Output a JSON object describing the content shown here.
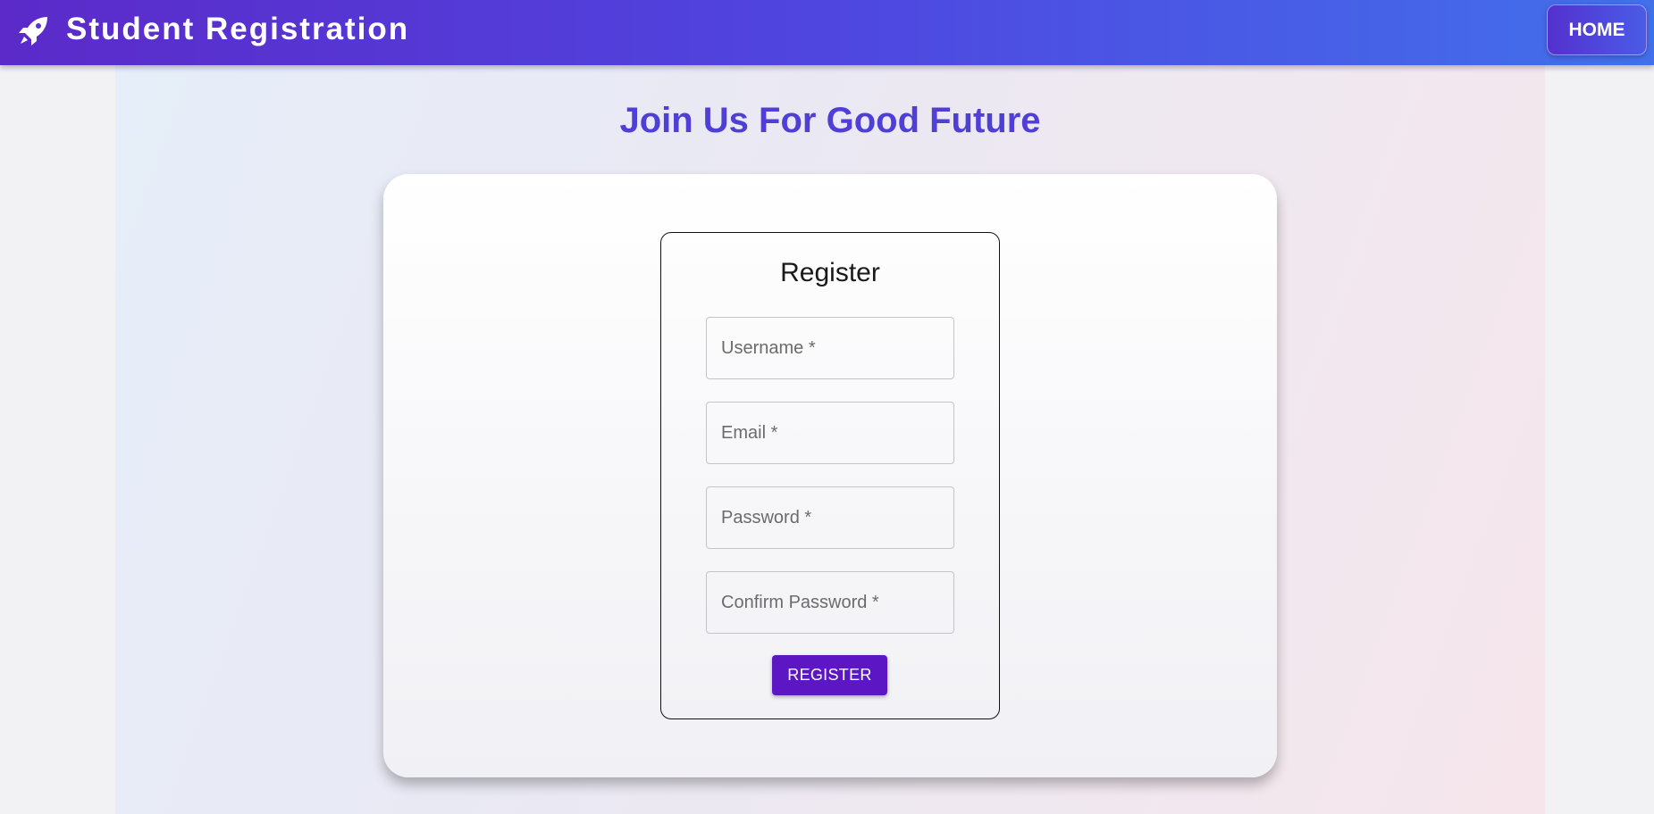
{
  "header": {
    "icon": "rocket-icon",
    "title": "Student Registration",
    "home_label": "HOME"
  },
  "main": {
    "heading": "Join Us For Good Future"
  },
  "form": {
    "title": "Register",
    "fields": [
      {
        "placeholder": "Username *",
        "value": ""
      },
      {
        "placeholder": "Email *",
        "value": ""
      },
      {
        "placeholder": "Password *",
        "value": ""
      },
      {
        "placeholder": "Confirm Password *",
        "value": ""
      }
    ],
    "submit_label": "REGISTER"
  },
  "colors": {
    "appbar_start": "#5b2ac9",
    "appbar_end": "#4270eb",
    "heading": "#4f3fd6",
    "button": "#5d16c4"
  }
}
